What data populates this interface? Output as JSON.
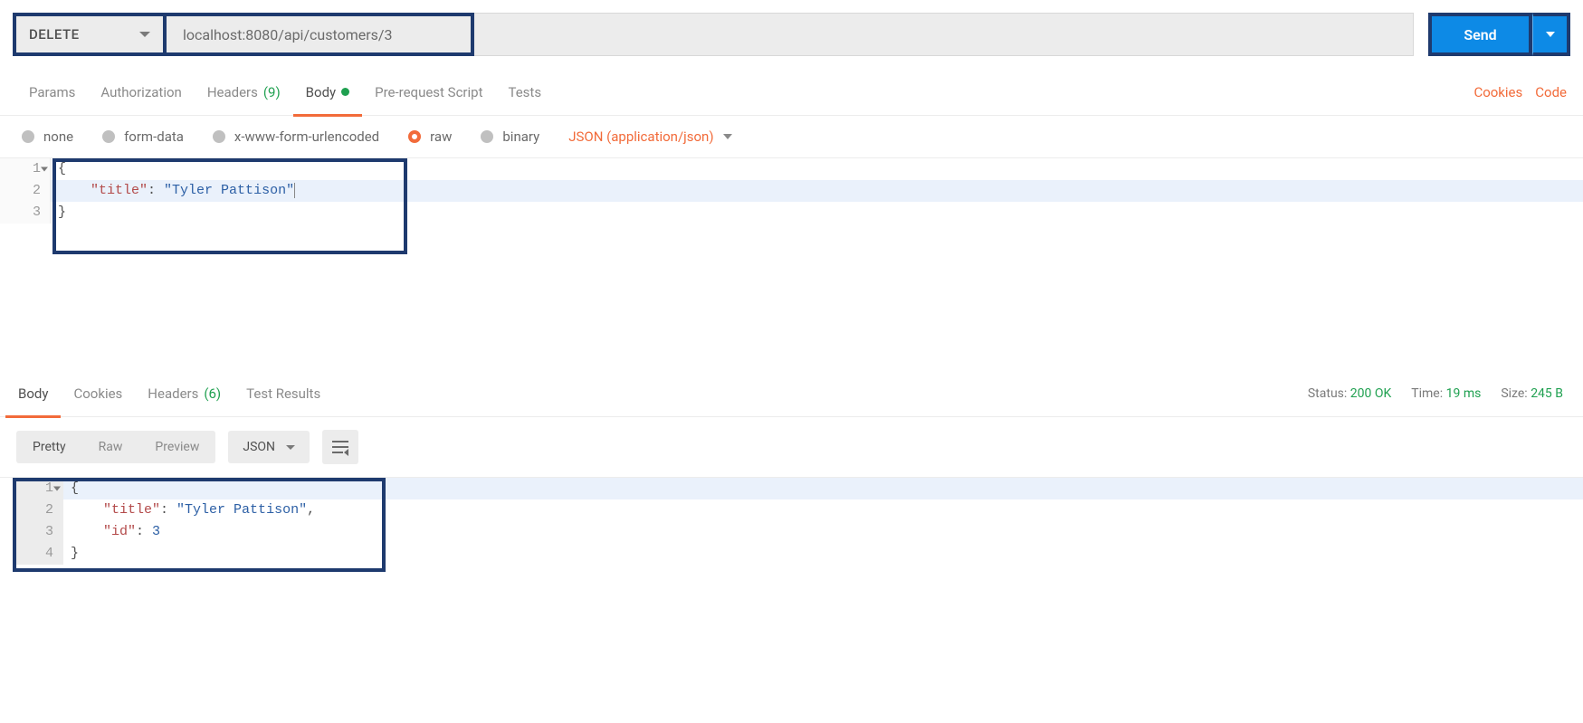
{
  "request": {
    "method": "DELETE",
    "url": "localhost:8080/api/customers/3",
    "send_label": "Send",
    "tabs": {
      "params": "Params",
      "authorization": "Authorization",
      "headers_label": "Headers",
      "headers_count": "(9)",
      "body": "Body",
      "prerequest": "Pre-request Script",
      "tests": "Tests"
    },
    "right_links": {
      "cookies": "Cookies",
      "code": "Code"
    },
    "body_types": {
      "none": "none",
      "form_data": "form-data",
      "urlencoded": "x-www-form-urlencoded",
      "raw": "raw",
      "binary": "binary"
    },
    "content_type": "JSON (application/json)",
    "body_lines": {
      "l1_num": "1",
      "l1_code": "{",
      "l2_num": "2",
      "l2_key": "\"title\"",
      "l2_sep": ": ",
      "l2_val": "\"Tyler Pattison\"",
      "l3_num": "3",
      "l3_code": "}"
    }
  },
  "response": {
    "tabs": {
      "body": "Body",
      "cookies": "Cookies",
      "headers_label": "Headers",
      "headers_count": "(6)",
      "test_results": "Test Results"
    },
    "meta": {
      "status_label": "Status:",
      "status_value": "200 OK",
      "time_label": "Time:",
      "time_value": "19 ms",
      "size_label": "Size:",
      "size_value": "245 B"
    },
    "view_modes": {
      "pretty": "Pretty",
      "raw": "Raw",
      "preview": "Preview"
    },
    "format_select": "JSON",
    "body_lines": {
      "l1_num": "1",
      "l1_code": "{",
      "l2_num": "2",
      "l2_key": "\"title\"",
      "l2_sep": ": ",
      "l2_val": "\"Tyler Pattison\"",
      "l2_comma": ",",
      "l3_num": "3",
      "l3_key": "\"id\"",
      "l3_sep": ": ",
      "l3_val": "3",
      "l4_num": "4",
      "l4_code": "}"
    }
  }
}
